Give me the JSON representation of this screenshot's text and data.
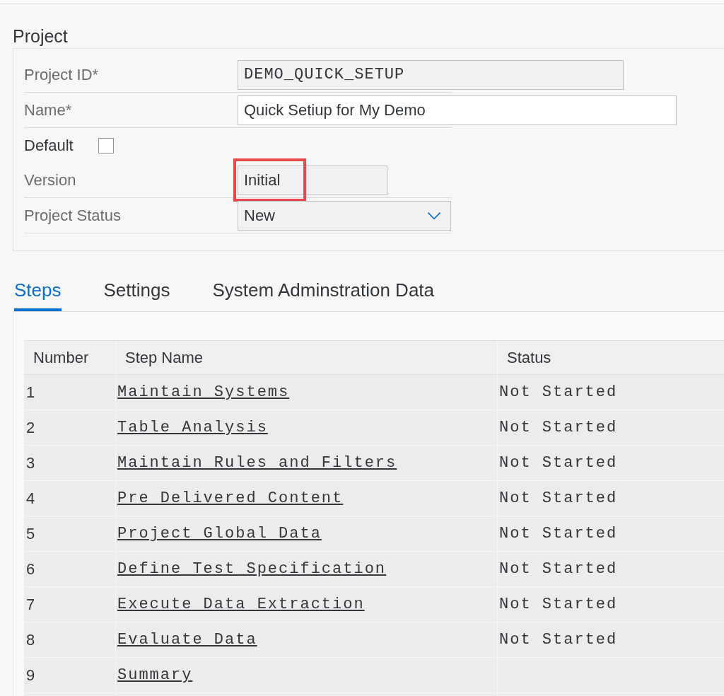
{
  "section_title": "Project",
  "fields": [
    {
      "kind": "readonly",
      "label": "Project ID*",
      "value": "DEMO_QUICK_SETUP",
      "highlighted": false
    },
    {
      "kind": "input",
      "label": "Name*",
      "value": "Quick Setiup for My Demo",
      "highlighted": false
    },
    {
      "kind": "checkbox",
      "label": "Default",
      "checked": false
    },
    {
      "kind": "readonly-short",
      "label": "Version",
      "value": "Initial",
      "highlighted": true
    },
    {
      "kind": "select",
      "label": "Project Status",
      "value": "New",
      "highlighted": false
    }
  ],
  "tabs": [
    {
      "label": "Steps",
      "selected": true
    },
    {
      "label": "Settings",
      "selected": false
    },
    {
      "label": "System Adminstration Data",
      "selected": false
    }
  ],
  "table": {
    "columns": [
      "Number",
      "Step Name",
      "Status"
    ],
    "rows": [
      {
        "number": "1",
        "step_name": "Maintain Systems",
        "status": "Not Started"
      },
      {
        "number": "2",
        "step_name": "Table Analysis",
        "status": "Not Started"
      },
      {
        "number": "3",
        "step_name": "Maintain Rules and Filters",
        "status": "Not Started"
      },
      {
        "number": "4",
        "step_name": "Pre Delivered Content",
        "status": "Not Started"
      },
      {
        "number": "5",
        "step_name": "Project Global Data",
        "status": "Not Started"
      },
      {
        "number": "6",
        "step_name": "Define Test Specification",
        "status": "Not Started"
      },
      {
        "number": "7",
        "step_name": "Execute Data Extraction",
        "status": "Not Started"
      },
      {
        "number": "8",
        "step_name": "Evaluate Data",
        "status": "Not Started"
      },
      {
        "number": "9",
        "step_name": "Summary"
      }
    ]
  }
}
